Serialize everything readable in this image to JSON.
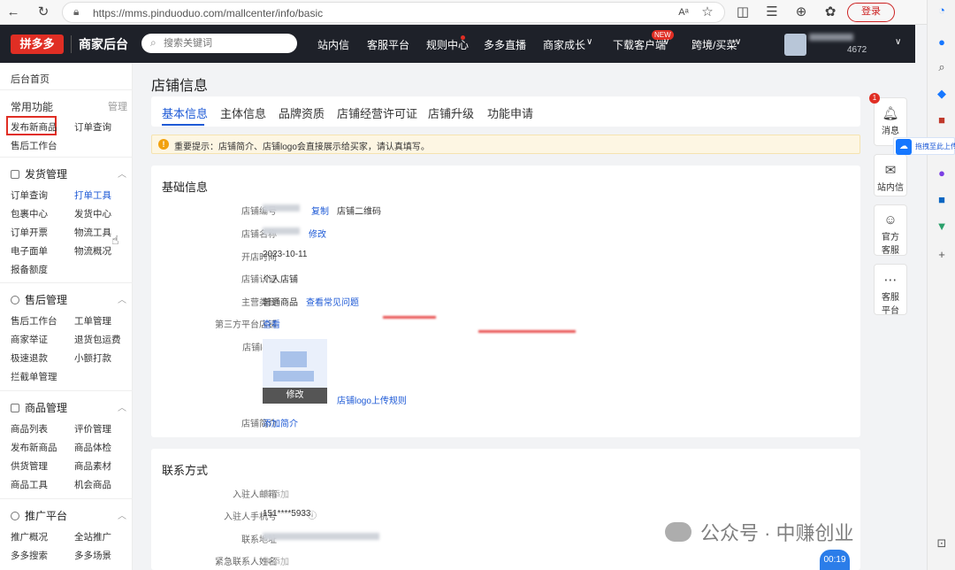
{
  "browser": {
    "url": "https://mms.pinduoduo.com/mallcenter/info/basic",
    "login_label": "登录"
  },
  "topnav": {
    "brand_mark": "拼多多",
    "brand_text": "商家后台",
    "search_placeholder": "搜索关键词",
    "items": [
      "站内信",
      "客服平台",
      "规则中心",
      "多多直播",
      "商家成长",
      "下载客户端",
      "跨境/买菜"
    ],
    "new_badge": "NEW",
    "account_suffix": "4672"
  },
  "sidebar": {
    "home": "后台首页",
    "common_title": "常用功能",
    "common_manage": "管理",
    "common_links": [
      "发布新商品",
      "订单查询",
      "售后工作台"
    ],
    "sections": [
      {
        "title": "发货管理",
        "links": [
          "订单查询",
          "打单工具",
          "包裹中心",
          "发货中心",
          "订单开票",
          "物流工具",
          "电子面单",
          "物流概况",
          "报备额度"
        ]
      },
      {
        "title": "售后管理",
        "links": [
          "售后工作台",
          "工单管理",
          "商家举证",
          "退货包运费",
          "极速退款",
          "小额打款",
          "拦截单管理"
        ]
      },
      {
        "title": "商品管理",
        "links": [
          "商品列表",
          "评价管理",
          "发布新商品",
          "商品体检",
          "供货管理",
          "商品素材",
          "商品工具",
          "机会商品"
        ]
      },
      {
        "title": "推广平台",
        "links": [
          "推广概况",
          "全站推广",
          "多多搜索",
          "多多场景"
        ]
      }
    ]
  },
  "main": {
    "page_title": "店铺信息",
    "tabs": [
      "基本信息",
      "主体信息",
      "品牌资质",
      "店铺经营许可证",
      "店铺升级",
      "功能申请"
    ],
    "notice": "重要提示：店铺简介、店铺logo会直接展示给买家，请认真填写。",
    "basic": {
      "title": "基础信息",
      "shop_id_label": "店铺编号",
      "copy": "复制",
      "qrcode": "店铺二维码",
      "shop_name_label": "店铺名称",
      "edit": "修改",
      "open_time_label": "开店时间",
      "open_time": "2023-10-11",
      "cert_label": "店铺认证",
      "cert": "个人店铺",
      "category_label": "主营类目",
      "category": "普通商品",
      "faq": "查看常见问题",
      "third_label": "第三方平台店铺",
      "third_view": "查看",
      "logo_label": "店铺logo",
      "logo_edit": "修改",
      "logo_rules": "店铺logo上传规则",
      "intro_label": "店铺简介",
      "intro_add": "添加简介"
    },
    "contact": {
      "title": "联系方式",
      "email_label": "入驻人邮箱",
      "email": "未添加",
      "phone_label": "入驻人手机号",
      "phone": "151****5933",
      "addr_label": "联系地址",
      "emergency_label": "紧急联系人姓名",
      "emergency": "未添加"
    }
  },
  "right_panel": {
    "badge": "1",
    "items": [
      "消息",
      "站内信",
      "官方客服",
      "客服平台"
    ],
    "upload_tag": "拖拽至此上传"
  },
  "timer": "00:19",
  "watermark": "公众号 · 中赚创业"
}
